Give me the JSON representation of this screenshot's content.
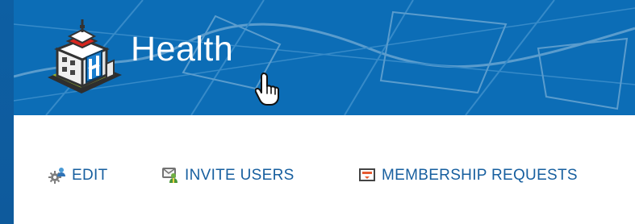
{
  "header": {
    "title": "Health",
    "logo_icon": "hospital-building-icon",
    "background_color": "#0c6db6"
  },
  "toolbar": {
    "actions": [
      {
        "label": "EDIT",
        "icon": "gear-people-icon"
      },
      {
        "label": "INVITE USERS",
        "icon": "invite-users-icon"
      },
      {
        "label": "MEMBERSHIP REQUESTS",
        "icon": "membership-requests-icon"
      }
    ]
  },
  "cursor": {
    "icon": "hand-pointer-icon"
  },
  "colors": {
    "action_text": "#175f9f",
    "page_background": "#ffffff"
  }
}
